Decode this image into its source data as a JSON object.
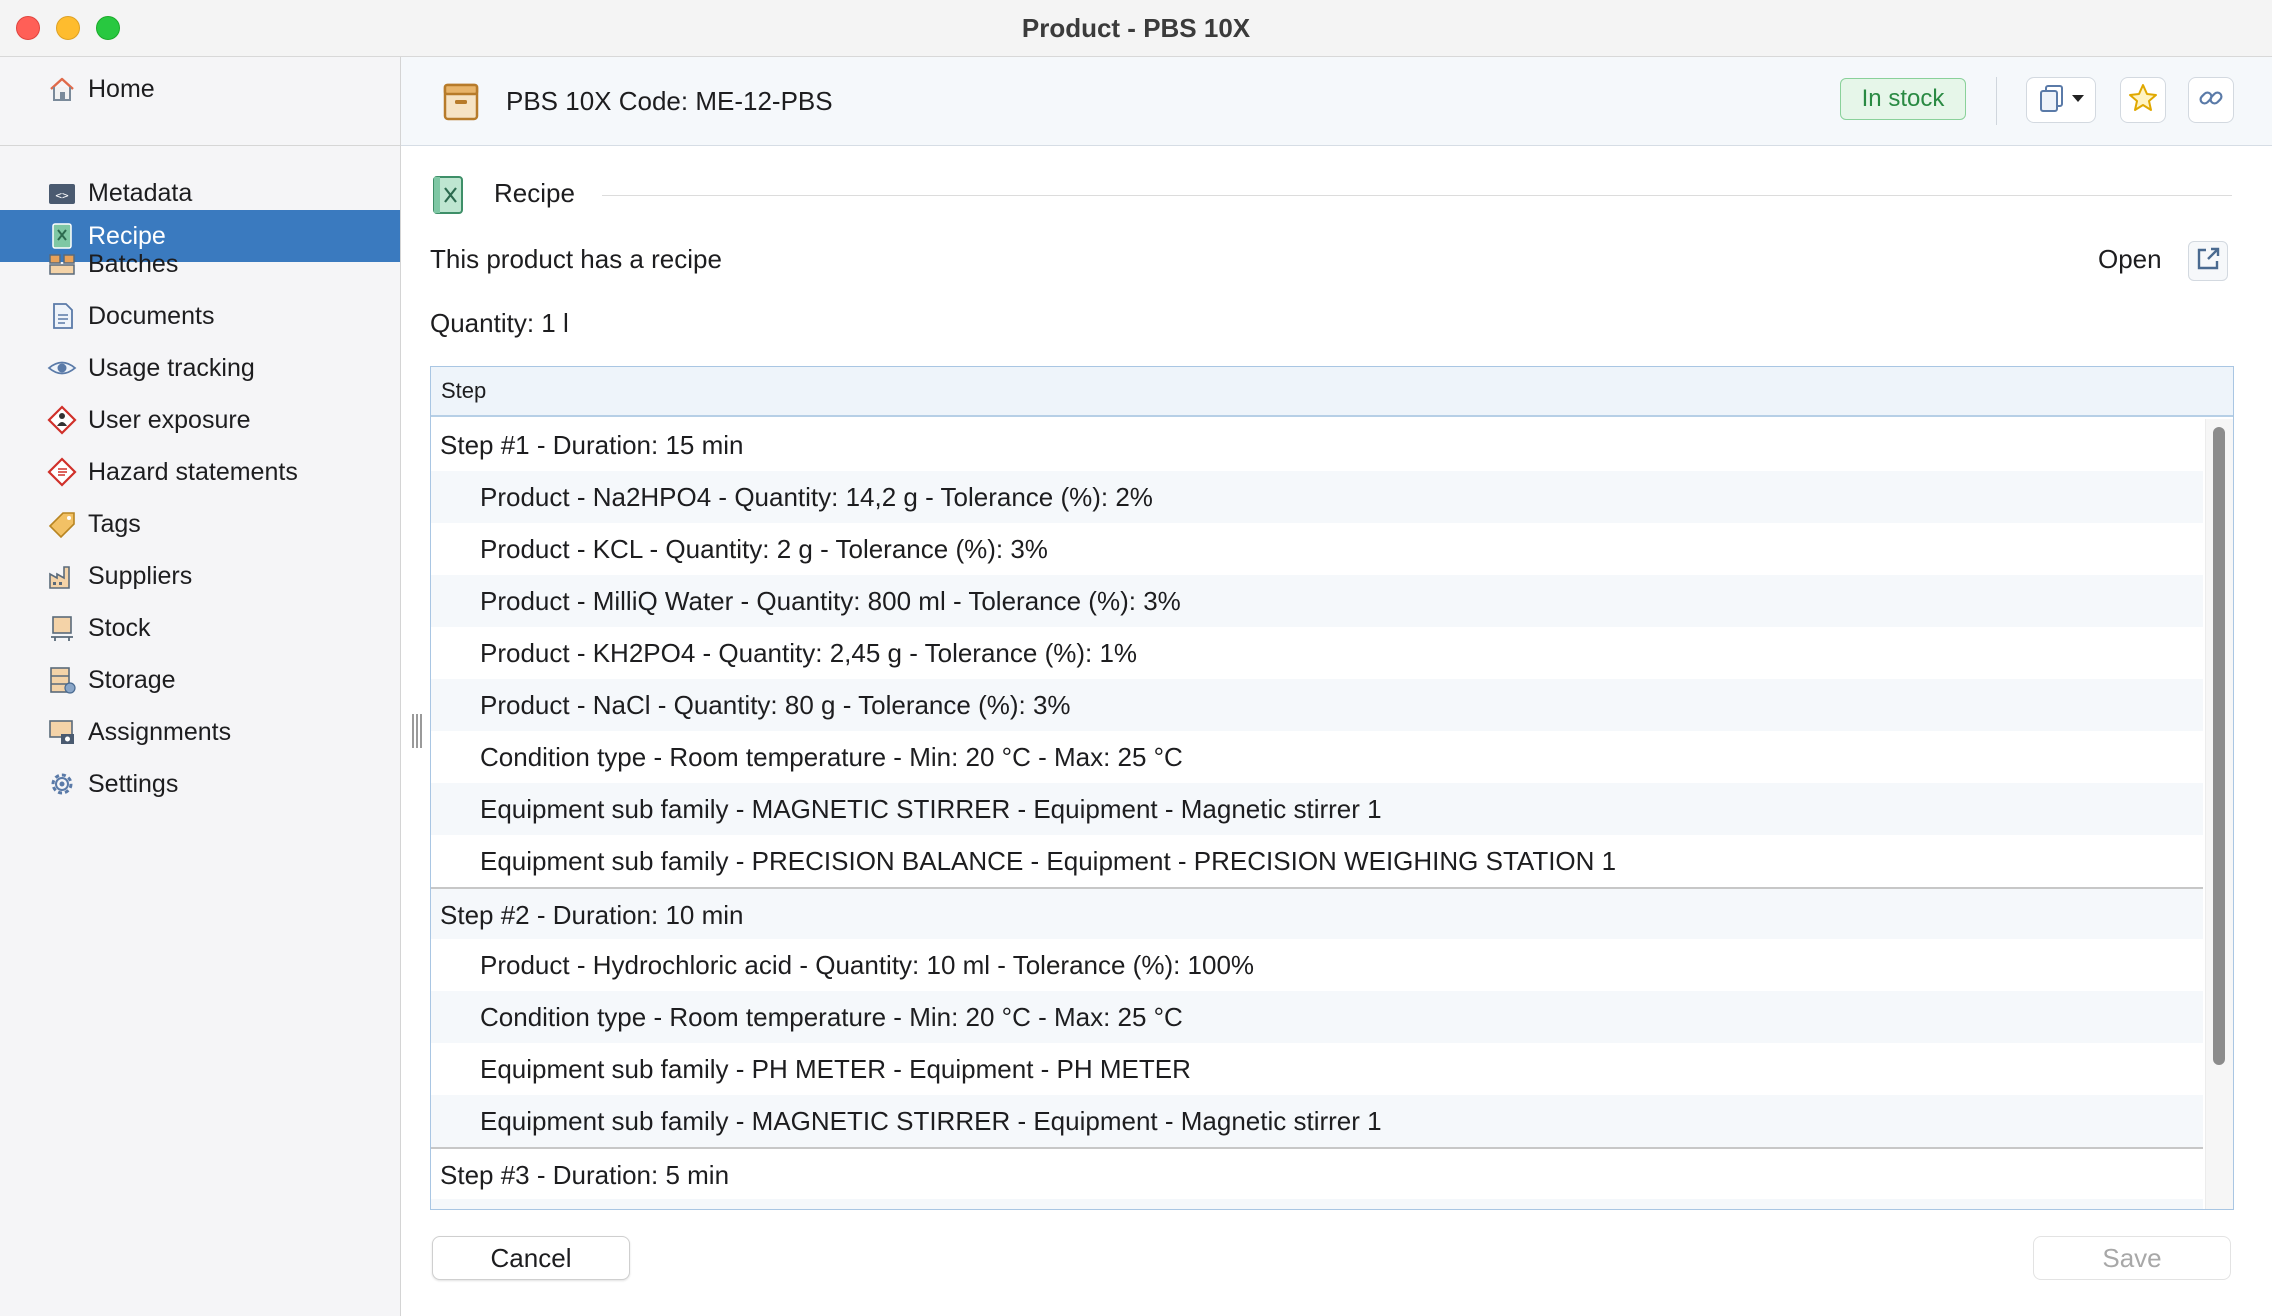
{
  "window": {
    "title": "Product - PBS 10X"
  },
  "sidebar": {
    "home": {
      "label": "Home",
      "icon": "home-icon"
    },
    "items": [
      {
        "label": "Metadata",
        "icon": "metadata-icon"
      },
      {
        "label": "Recipe",
        "icon": "recipe-icon",
        "active": true
      },
      {
        "label": "Batches",
        "icon": "batches-icon"
      },
      {
        "label": "Documents",
        "icon": "documents-icon"
      },
      {
        "label": "Usage tracking",
        "icon": "eye-icon"
      },
      {
        "label": "User exposure",
        "icon": "exposure-icon"
      },
      {
        "label": "Hazard statements",
        "icon": "hazard-icon"
      },
      {
        "label": "Tags",
        "icon": "tag-icon"
      },
      {
        "label": "Suppliers",
        "icon": "factory-icon"
      },
      {
        "label": "Stock",
        "icon": "stock-icon"
      },
      {
        "label": "Storage",
        "icon": "storage-icon"
      },
      {
        "label": "Assignments",
        "icon": "assignments-icon"
      },
      {
        "label": "Settings",
        "icon": "gear-icon"
      }
    ]
  },
  "header": {
    "title": "PBS 10X Code: ME-12-PBS",
    "status": "In stock",
    "status_color": "#2a8a43"
  },
  "main": {
    "section_title": "Recipe",
    "has_recipe_text": "This product has a recipe",
    "open_label": "Open",
    "quantity": "Quantity: 1 l",
    "table": {
      "column_header": "Step",
      "rows": [
        {
          "type": "step",
          "text": "Step #1 - Duration: 15 min"
        },
        {
          "type": "sub",
          "text": "Product - Na2HPO4 - Quantity: 14,2 g - Tolerance (%): 2%"
        },
        {
          "type": "sub",
          "text": "Product - KCL - Quantity: 2 g - Tolerance (%): 3%"
        },
        {
          "type": "sub",
          "text": "Product - MilliQ Water - Quantity: 800 ml - Tolerance (%): 3%"
        },
        {
          "type": "sub",
          "text": "Product - KH2PO4 - Quantity: 2,45 g - Tolerance (%): 1%"
        },
        {
          "type": "sub",
          "text": "Product - NaCl - Quantity: 80 g - Tolerance (%): 3%"
        },
        {
          "type": "sub",
          "text": "Condition type - Room temperature - Min: 20 °C - Max: 25 °C"
        },
        {
          "type": "sub",
          "text": "Equipment sub family - MAGNETIC STIRRER - Equipment - Magnetic stirrer 1"
        },
        {
          "type": "sub",
          "text": "Equipment sub family - PRECISION BALANCE - Equipment - PRECISION WEIGHING STATION 1"
        },
        {
          "type": "step",
          "text": "Step #2 - Duration: 10 min"
        },
        {
          "type": "sub",
          "text": "Product - Hydrochloric acid - Quantity: 10 ml - Tolerance (%): 100%"
        },
        {
          "type": "sub",
          "text": "Condition type - Room temperature - Min: 20 °C - Max: 25 °C"
        },
        {
          "type": "sub",
          "text": "Equipment sub family - PH METER - Equipment - PH METER"
        },
        {
          "type": "sub",
          "text": "Equipment sub family - MAGNETIC STIRRER - Equipment - Magnetic stirrer 1"
        },
        {
          "type": "step",
          "text": "Step #3 - Duration: 5 min"
        },
        {
          "type": "sub",
          "text": ""
        }
      ]
    },
    "buttons": {
      "cancel": "Cancel",
      "save": "Save"
    }
  },
  "colors": {
    "accent": "#3a7abf",
    "table_border": "#a9c6e3",
    "badge_bg": "#e6f6e9"
  }
}
